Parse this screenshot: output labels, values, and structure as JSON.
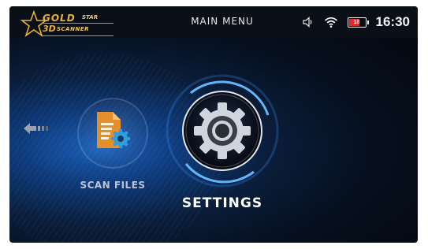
{
  "header": {
    "logo_gold": "GOLD",
    "logo_star": "STAR",
    "logo_3d": "3D",
    "logo_scanner": "SCANNER",
    "title": "MAIN MENU",
    "battery_level": "18",
    "time": "16:30"
  },
  "menu": {
    "items": [
      {
        "label": "SCAN FILES",
        "icon": "document-gear-icon"
      },
      {
        "label": "SETTINGS",
        "icon": "gear-icon",
        "selected": true
      }
    ]
  },
  "colors": {
    "brand_gold": "#e8b23a",
    "accent_blue": "#2c8cff",
    "battery_low": "#e22b2b"
  }
}
